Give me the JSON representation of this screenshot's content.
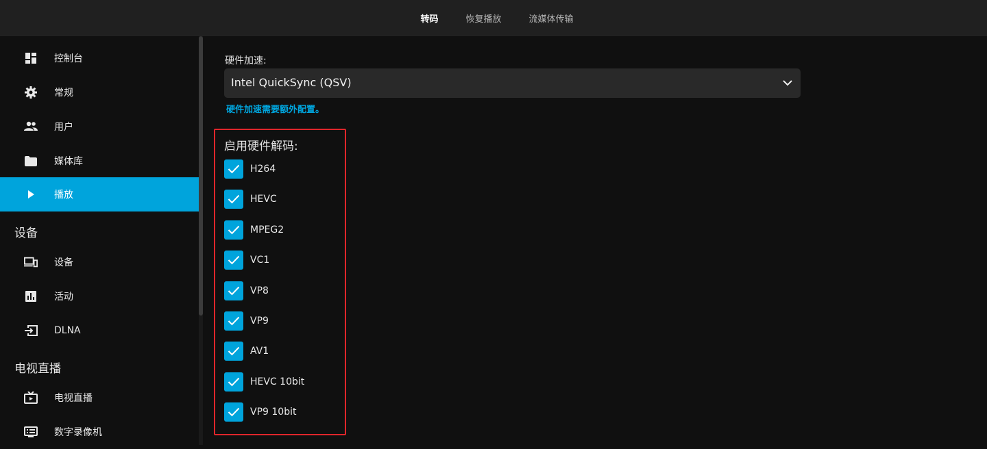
{
  "header": {
    "tabs": [
      {
        "label": "转码",
        "active": true
      },
      {
        "label": "恢复播放",
        "active": false
      },
      {
        "label": "流媒体传输",
        "active": false
      }
    ]
  },
  "sidebar": {
    "items": [
      {
        "label": "控制台",
        "icon": "dashboard-icon"
      },
      {
        "label": "常规",
        "icon": "gear-icon"
      },
      {
        "label": "用户",
        "icon": "users-icon"
      },
      {
        "label": "媒体库",
        "icon": "folder-icon"
      },
      {
        "label": "播放",
        "icon": "play-icon",
        "active": true
      }
    ],
    "section_devices": "设备",
    "device_items": [
      {
        "label": "设备",
        "icon": "devices-icon"
      },
      {
        "label": "活动",
        "icon": "activity-chart-icon"
      },
      {
        "label": "DLNA",
        "icon": "input-arrow-icon"
      }
    ],
    "section_livetv": "电视直播",
    "livetv_items": [
      {
        "label": "电视直播",
        "icon": "live-tv-icon"
      },
      {
        "label": "数字录像机",
        "icon": "dvr-icon"
      }
    ]
  },
  "main": {
    "hw_accel_label": "硬件加速:",
    "hw_accel_value": "Intel QuickSync (QSV)",
    "hw_accel_help": "硬件加速需要额外配置。",
    "decode_label": "启用硬件解码:",
    "codecs": [
      {
        "label": "H264",
        "checked": true
      },
      {
        "label": "HEVC",
        "checked": true
      },
      {
        "label": "MPEG2",
        "checked": true
      },
      {
        "label": "VC1",
        "checked": true
      },
      {
        "label": "VP8",
        "checked": true
      },
      {
        "label": "VP9",
        "checked": true
      },
      {
        "label": "AV1",
        "checked": true
      },
      {
        "label": "HEVC 10bit",
        "checked": true
      },
      {
        "label": "VP9 10bit",
        "checked": true
      }
    ]
  },
  "colors": {
    "accent": "#00a4dc",
    "highlight": "#e0262b",
    "background": "#101010",
    "topbar": "#202020"
  }
}
